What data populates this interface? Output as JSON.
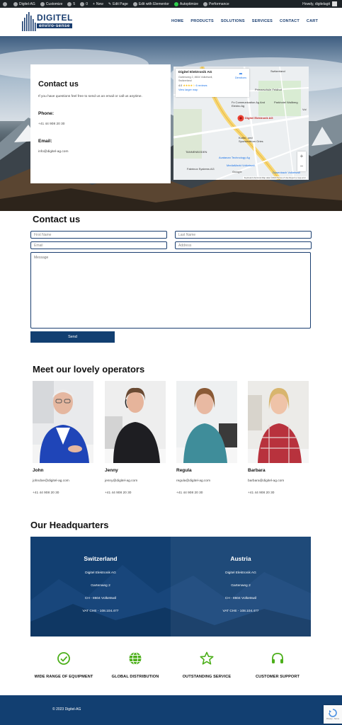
{
  "adminbar": {
    "site": "Digitel-AG",
    "customize": "Customize",
    "updates": "5",
    "comments": "0",
    "new": "New",
    "edit_page": "Edit Page",
    "elementor": "Edit with Elementor",
    "autoptimize": "Autoptimize",
    "performance": "Performance",
    "howdy": "Howdy, digitelagit"
  },
  "header": {
    "logo_main": "DIGITEL",
    "logo_sub": "enviro-sense",
    "nav": [
      "HOME",
      "PRODUCTS",
      "SOLUTIONS",
      "SERVICES",
      "CONTACT",
      "CART"
    ]
  },
  "hero": {
    "card": {
      "title": "Contact us",
      "intro": "If you have questions feel free to send us an email or call us anytime.",
      "phone_label": "Phone:",
      "phone": "+41 44 908 20 30",
      "email_label": "Email:",
      "email": "info@digitel-ag.com"
    },
    "map": {
      "name": "Digitel Elektronik AG",
      "address": "Gartenweg 2, 8604 Volketswil, Switzerland",
      "rating": "4.0",
      "stars": "★★★★☆",
      "reviews": "6 reviews",
      "larger": "View larger map",
      "directions": "Directions",
      "pin_label": "Digitel Elektronik AG",
      "labels": {
        "switzerland": "Switzerland",
        "fz": "Fz Communication Ag And Elektro Ag",
        "primar": "Primarschule Feldhof",
        "parkhotel": "Parkhotel Wallberg",
        "kultur": "Kultur- und Sportzentrum Gries",
        "tannenboden": "TANNENBODEN",
        "avatanan": "Avatanan Technology Ag",
        "mediamarkt": "MediaMarkt Volketswil",
        "fabrinox": "Fabrinox Systems AG",
        "dosenbach": "Dosenbach Volketswil",
        "vol": "Vol",
        "google": "Google"
      },
      "footer": "Keyboard shortcuts   Map data ©2023   Terms of Use   Report a map error"
    }
  },
  "form": {
    "title": "Contact us",
    "first_name": "First Name",
    "last_name": "Last Name",
    "email": "Email",
    "address": "Address",
    "message": "Message",
    "send": "Send"
  },
  "operators": {
    "title": "Meet our lovely operators",
    "people": [
      {
        "name": "John",
        "email": "johndoe@digitel-ag.com",
        "phone": "+41 44 908 20 30"
      },
      {
        "name": "Jenny",
        "email": "jenny@digitel-ag.com",
        "phone": "+41 44 908 20 30"
      },
      {
        "name": "Regula",
        "email": "regula@digitel-ag.com",
        "phone": "+41 44 908 20 30"
      },
      {
        "name": "Barbara",
        "email": "barbara@digitel-ag.com",
        "phone": "+41 44 908 20 30"
      }
    ]
  },
  "hq": {
    "title": "Our Headquarters",
    "offices": [
      {
        "country": "Switzerland",
        "company": "Digitel Elektronik AG",
        "street": "Gartenweg 2",
        "city": "CH - 8604 Volketswil",
        "vat": "VAT CHE - 108.104.477"
      },
      {
        "country": "Austria",
        "company": "Digitel Elektronik AG",
        "street": "Gartenweg 2",
        "city": "CH - 8604 Volketswil",
        "vat": "VAT CHE - 108.104.477"
      }
    ]
  },
  "features": [
    {
      "label": "WIDE RANGE OF EQUIPMENT",
      "icon": "check-circle-icon"
    },
    {
      "label": "GLOBAL DISTRIBUTION",
      "icon": "globe-icon"
    },
    {
      "label": "OUTSTANDING SERVICE",
      "icon": "star-icon"
    },
    {
      "label": "CUSTOMER SUPPORT",
      "icon": "headset-icon"
    }
  ],
  "footer": {
    "copyright": "© 2023 Digitel-AG",
    "recaptcha": "Privacy - Terms"
  },
  "colors": {
    "brand": "#123f71",
    "accent_green": "#4caf1a",
    "adminbar": "#1d2327"
  }
}
